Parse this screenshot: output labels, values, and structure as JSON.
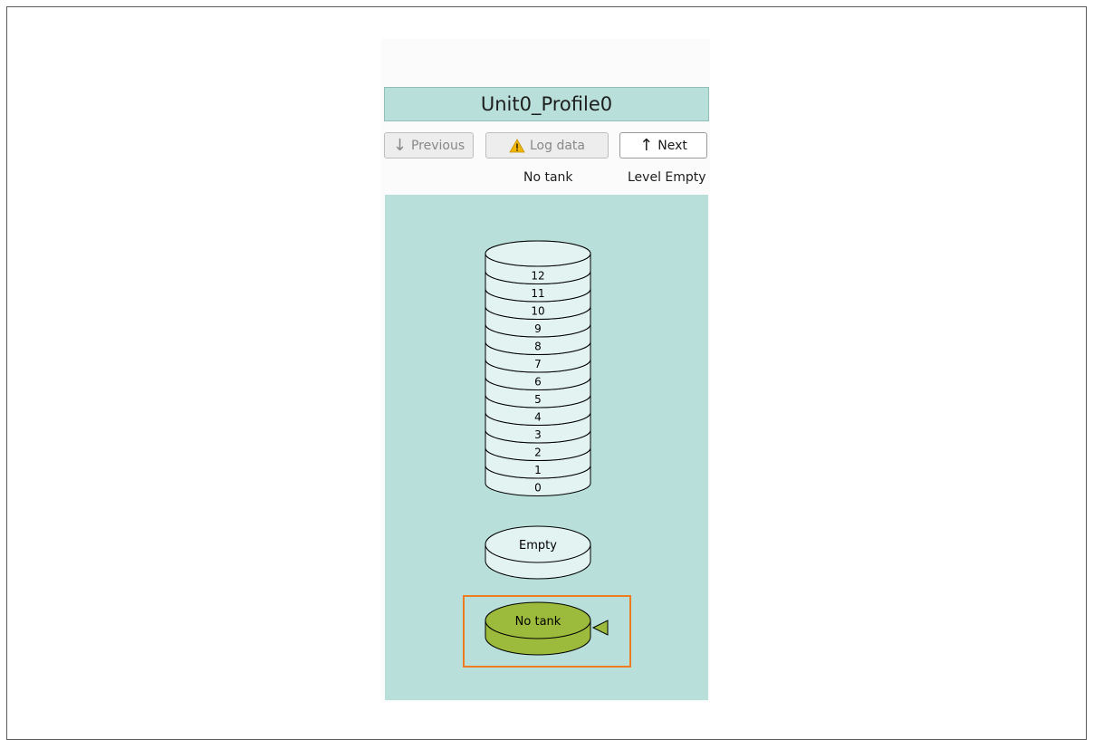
{
  "profile": {
    "title": "Unit0_Profile0"
  },
  "toolbar": {
    "previous_label": "Previous",
    "log_label": "Log data",
    "next_label": "Next"
  },
  "status": {
    "tank": "No tank",
    "level": "Level Empty"
  },
  "levels": [
    "12",
    "11",
    "10",
    "9",
    "8",
    "7",
    "6",
    "5",
    "4",
    "3",
    "2",
    "1",
    "0"
  ],
  "empty_label": "Empty",
  "current_label": "No tank",
  "colors": {
    "panel_bg": "#b9dfda",
    "disk_fill": "#e3f3f1",
    "current_fill": "#9cbb3c",
    "highlight": "#ee7d1f",
    "warning": "#f2b705"
  }
}
